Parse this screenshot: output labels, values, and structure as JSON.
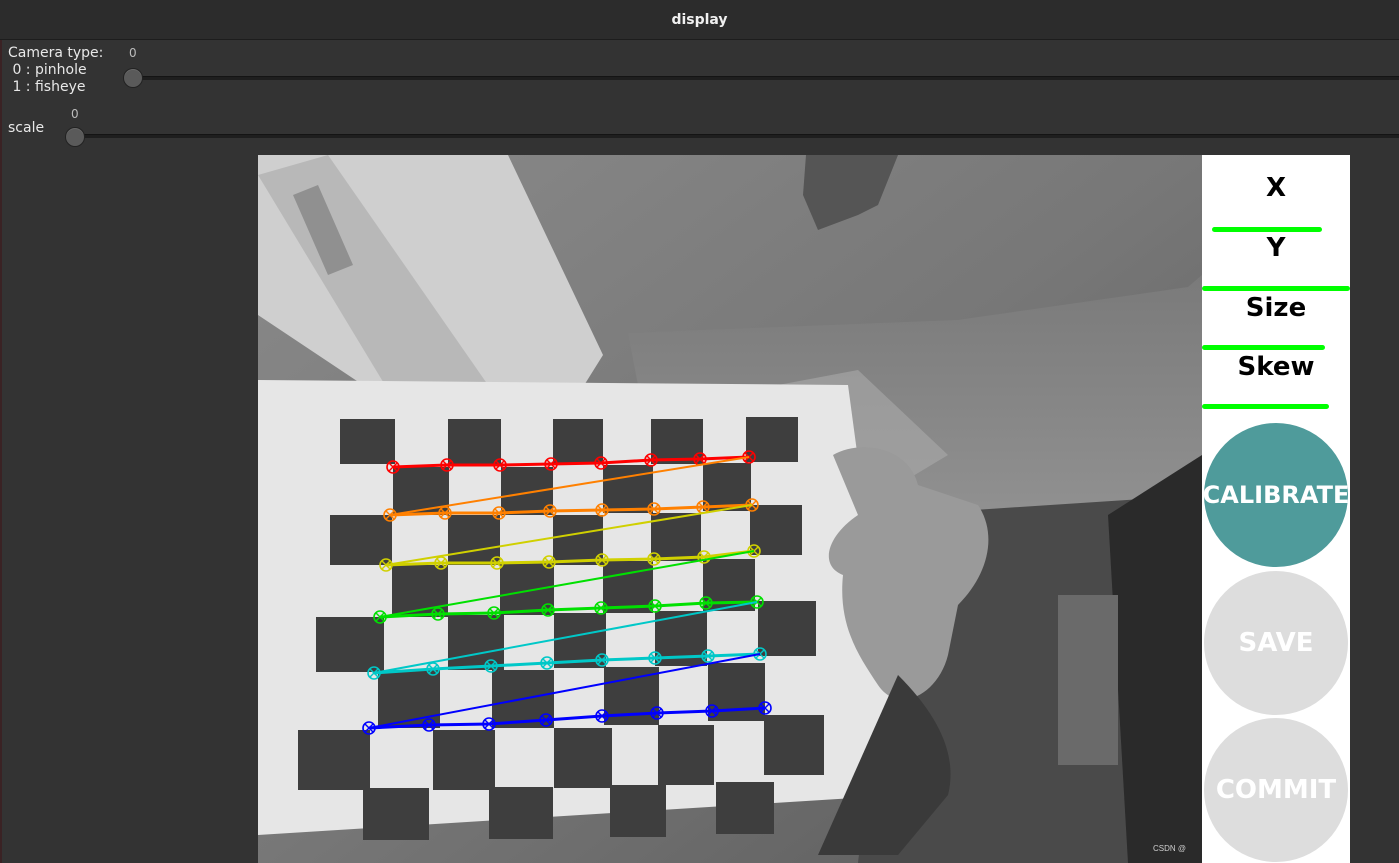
{
  "window": {
    "title": "display"
  },
  "trackbars": {
    "camera_type": {
      "label": "Camera type:\n 0 : pinhole\n 1 : fisheye",
      "value": "0"
    },
    "scale": {
      "label": "scale",
      "value": "0"
    }
  },
  "sidebar": {
    "metrics": [
      {
        "label": "X",
        "progress": 0.82
      },
      {
        "label": "Y",
        "progress": 1.0
      },
      {
        "label": "Size",
        "progress": 0.92
      },
      {
        "label": "Skew",
        "progress": 0.95
      }
    ],
    "bar_color": "#00ff00",
    "buttons": {
      "calibrate": {
        "label": "CALIBRATE",
        "color": "#4f9b9b",
        "enabled": true
      },
      "save": {
        "label": "SAVE",
        "color": "#dddddd",
        "enabled": false
      },
      "commit": {
        "label": "COMMIT",
        "color": "#dddddd",
        "enabled": false
      }
    }
  },
  "camera_view": {
    "content": "grayscale camera frame with chessboard calibration target",
    "detected_corner_rows": [
      {
        "color": "#ff0000"
      },
      {
        "color": "#ff8000"
      },
      {
        "color": "#d0d000"
      },
      {
        "color": "#00e000"
      },
      {
        "color": "#00c8c8"
      },
      {
        "color": "#0000ff"
      }
    ]
  },
  "watermark": "CSDN @"
}
